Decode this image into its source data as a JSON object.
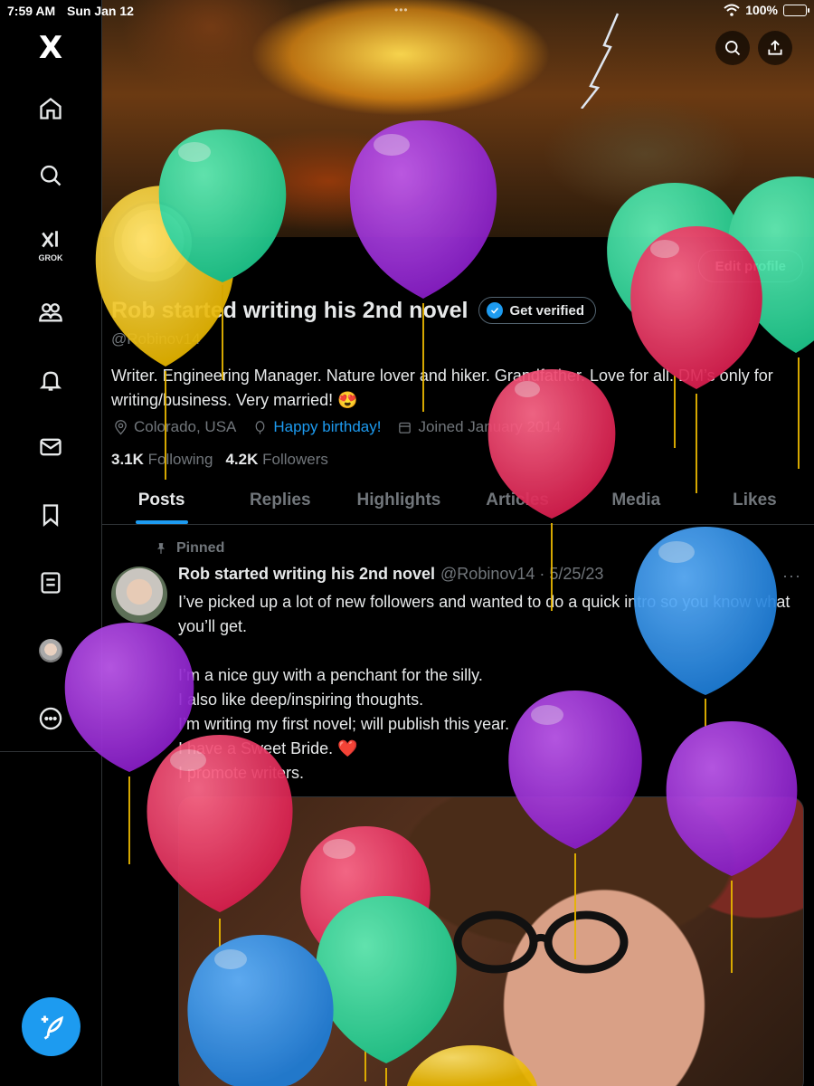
{
  "status_bar": {
    "time": "7:59 AM",
    "date": "Sun Jan 12",
    "dots": "•••",
    "battery": "100%"
  },
  "sidebar": {
    "logo": "X",
    "items": [
      {
        "icon": "home-icon"
      },
      {
        "icon": "search-icon"
      },
      {
        "icon": "grok-icon",
        "label": "GROK"
      },
      {
        "icon": "communities-icon"
      },
      {
        "icon": "notifications-icon"
      },
      {
        "icon": "messages-icon"
      },
      {
        "icon": "bookmarks-icon"
      },
      {
        "icon": "lists-icon"
      },
      {
        "icon": "profile-avatar-icon"
      },
      {
        "icon": "more-icon"
      }
    ],
    "compose_icon": "compose-icon"
  },
  "profile": {
    "display_name": "Rob started writing his 2nd novel",
    "get_verified": "Get verified",
    "edit_profile": "Edit profile",
    "handle": "@Robinov14",
    "bio": "Writer. Engineering Manager. Nature lover and hiker. Grandfather. Love for all. DM’s only for writing/business. Very married! 😍",
    "location": "Colorado, USA",
    "birthday": "Happy birthday!",
    "joined": "Joined January 2014",
    "following_count": "3.1K",
    "following_label": "Following",
    "followers_count": "4.2K",
    "followers_label": "Followers"
  },
  "tabs": [
    {
      "label": "Posts",
      "active": true
    },
    {
      "label": "Replies"
    },
    {
      "label": "Highlights"
    },
    {
      "label": "Articles"
    },
    {
      "label": "Media"
    },
    {
      "label": "Likes"
    }
  ],
  "post": {
    "pinned_label": "Pinned",
    "author": "Rob started writing his 2nd novel",
    "meta": "@Robinov14 · 5/25/23",
    "more": "···",
    "lines": [
      "I’ve picked up a lot of new followers and wanted to do a quick intro so you know what you’ll get.",
      "",
      "I’m a nice guy with a penchant for the silly.",
      "I also like deep/inspiring thoughts.",
      "I’m writing my first novel; will publish this year.",
      "I have a Sweet Bride. ❤️",
      "I promote writers."
    ]
  },
  "colors": {
    "accent": "#1d9bf0",
    "background": "#000000",
    "text": "#e7e9ea",
    "muted": "#71767b",
    "balloon_green": "#2fd39a",
    "balloon_purple": "#9b2fd6",
    "balloon_red": "#e8305f",
    "balloon_yellow": "#f1c21a",
    "balloon_blue": "#2f8fe0"
  }
}
